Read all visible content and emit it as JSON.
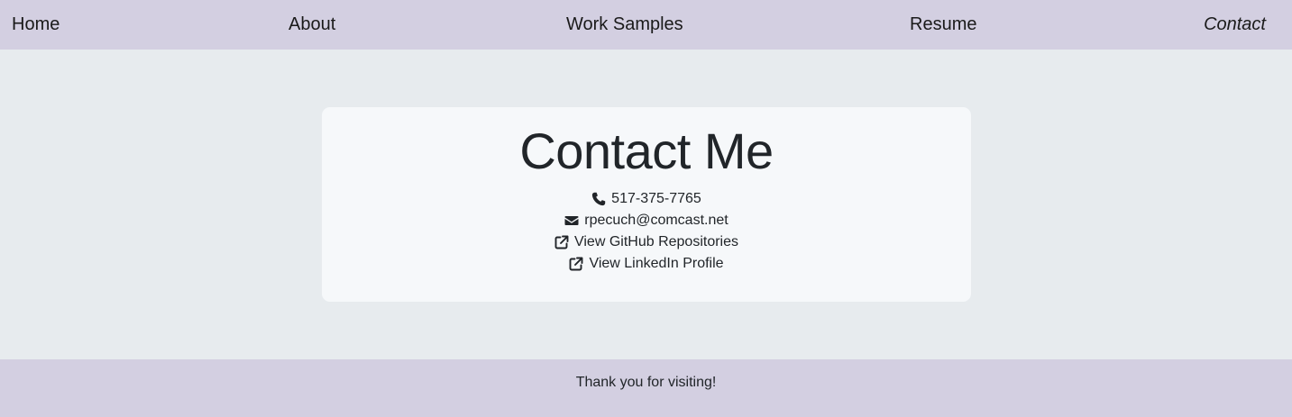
{
  "nav": {
    "home": "Home",
    "about": "About",
    "work_samples": "Work Samples",
    "resume": "Resume",
    "contact": "Contact"
  },
  "contact": {
    "title": "Contact Me",
    "phone": "517-375-7765",
    "email": "rpecuch@comcast.net",
    "github_label": "View GitHub Repositories",
    "linkedin_label": "View LinkedIn Profile"
  },
  "icons": {
    "phone": "phone-icon",
    "email": "envelope-icon",
    "external": "external-link-icon"
  },
  "colors": {
    "nav_background": "#d3cfe1",
    "page_background": "#e7ebee",
    "card_background": "#f6f8fa"
  },
  "footer": {
    "text": "Thank you for visiting!"
  }
}
